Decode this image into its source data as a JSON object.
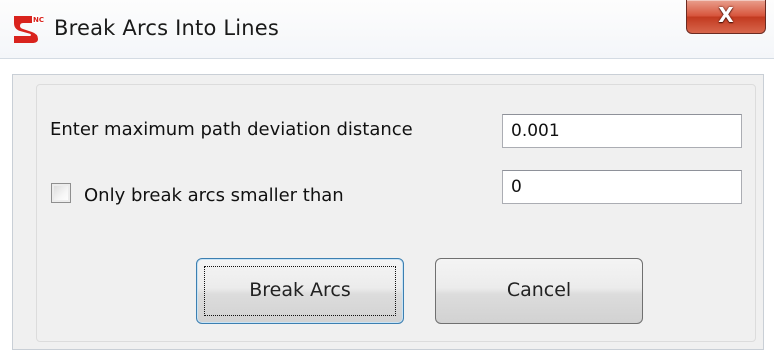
{
  "window": {
    "title": "Break Arcs Into Lines",
    "icon": "app-logo-icon",
    "close_glyph": "X"
  },
  "form": {
    "deviation_label": "Enter maximum path deviation distance",
    "deviation_value": "0.001",
    "only_smaller_label": "Only break arcs smaller than",
    "only_smaller_checked": false,
    "only_smaller_value": "0"
  },
  "buttons": {
    "break_arcs": "Break Arcs",
    "cancel": "Cancel"
  },
  "colors": {
    "close_red": "#c23a20",
    "client_bg": "#f0f0f0",
    "default_button_border": "#3c7fb1"
  }
}
